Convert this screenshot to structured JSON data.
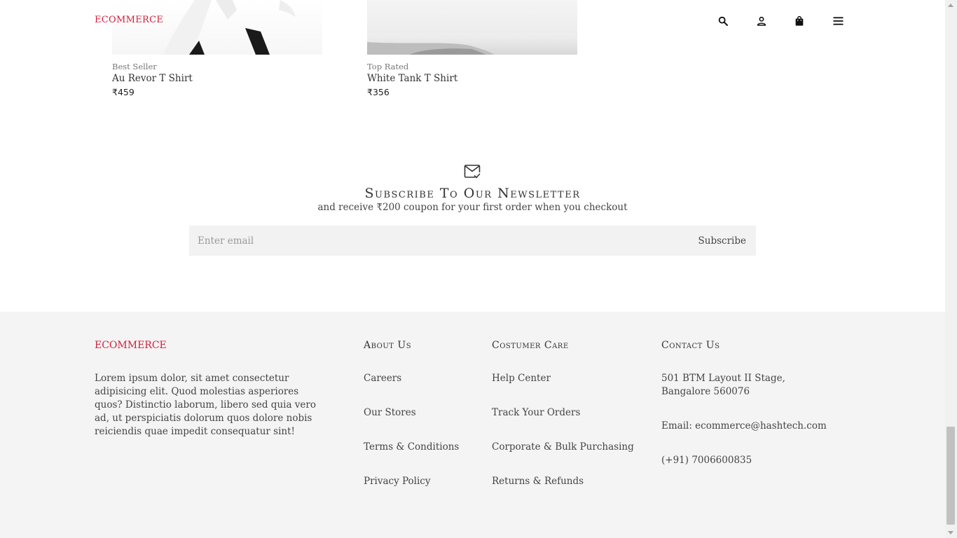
{
  "header": {
    "brand": "ECOMMERCE",
    "icons": [
      "search-icon",
      "user-icon",
      "shopping-bag-icon",
      "menu-icon"
    ]
  },
  "products": [
    {
      "tag": "Best Seller",
      "name": "Au Revor T Shirt",
      "price": "₹459"
    },
    {
      "tag": "Top Rated",
      "name": "White Tank T Shirt",
      "price": "₹356"
    }
  ],
  "newsletter": {
    "icon": "mail-check-icon",
    "title": "Subscribe To Our Newsletter",
    "subtitle": "and receive ₹200 coupon for your first order when you checkout",
    "email_placeholder": "Enter email",
    "email_value": "",
    "button_label": "Subscribe"
  },
  "footer": {
    "brand": "ECOMMERCE",
    "description": "Lorem ipsum dolor, sit amet consectetur adipisicing elit. Quod molestias asperiores quos? Distinctio laborum, libero sed quia vero ad, ut perspiciatis dolorum quos dolore nobis reiciendis quae impedit consequatur sint!",
    "about": {
      "heading": "About Us",
      "links": [
        "Careers",
        "Our Stores",
        "Terms & Conditions",
        "Privacy Policy"
      ]
    },
    "care": {
      "heading": "Costumer Care",
      "links": [
        "Help Center",
        "Track Your Orders",
        "Corporate & Bulk Purchasing",
        "Returns & Refunds"
      ]
    },
    "contact": {
      "heading": "Contact Us",
      "address": "501 BTM Layout II Stage, Bangalore 560076",
      "email": "Email: ecommerce@hashtech.com",
      "phone": "(+91) 7006600835"
    }
  },
  "colors": {
    "brand": "#d21f3c",
    "footer_bg": "#f4f4f4",
    "input_bg": "#f2f2f2"
  }
}
